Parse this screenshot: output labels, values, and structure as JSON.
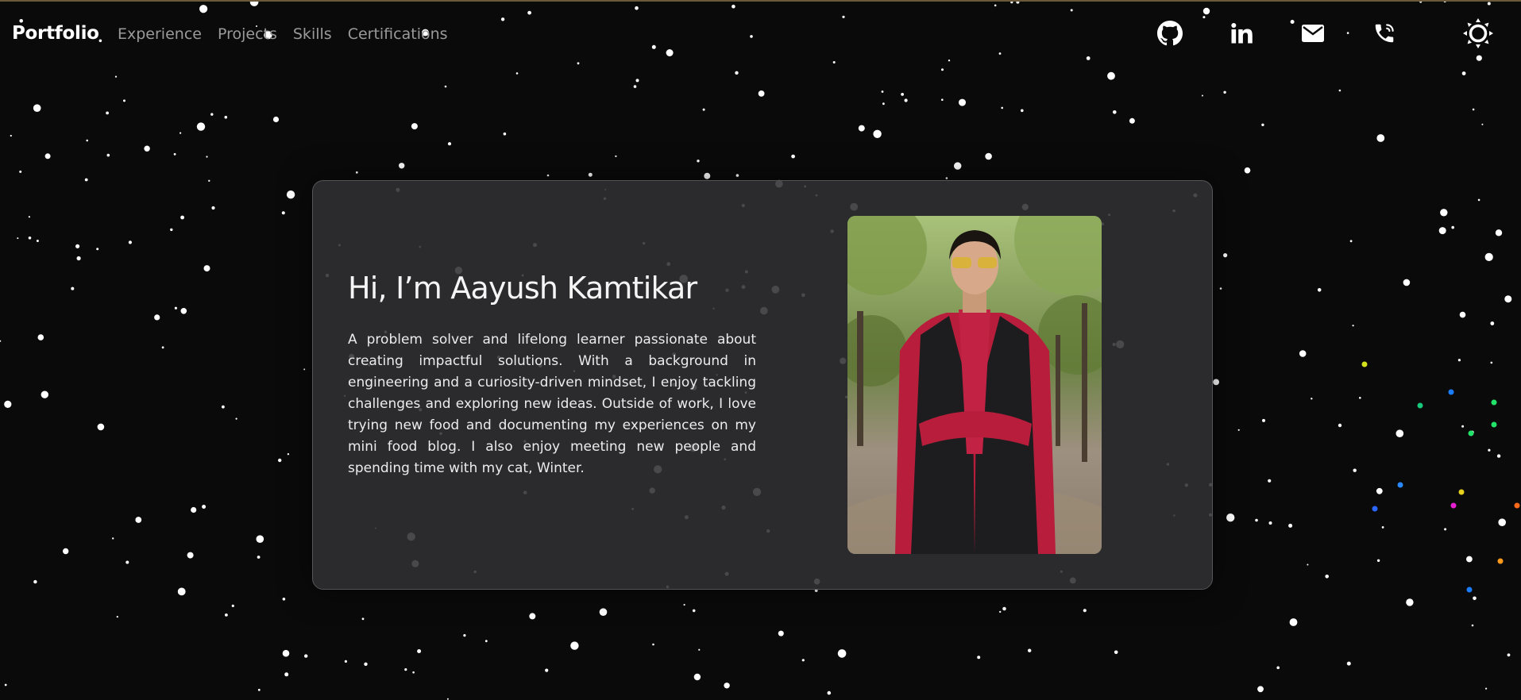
{
  "nav": {
    "brand": "Portfolio",
    "links": [
      "Experience",
      "Projects",
      "Skills",
      "Certifications"
    ],
    "icons": [
      "github-icon",
      "linkedin-icon",
      "mail-icon",
      "phone-icon",
      "theme-toggle-sun-icon"
    ]
  },
  "hero": {
    "title": "Hi, I’m Aayush Kamtikar",
    "description": "A problem solver and lifelong learner passionate about creating impactful solutions. With a background in engineering and a curiosity-driven mindset, I enjoy tackling challenges and exploring new ideas. Outside of work, I love trying new food and documenting my experiences on my mini food blog. I also enjoy meeting new people and spending time with my cat, Winter."
  },
  "colors": {
    "background": "#0a0a0b",
    "card": "#303032",
    "nav_text": "#9a9a9a",
    "star": "#ffffff"
  }
}
